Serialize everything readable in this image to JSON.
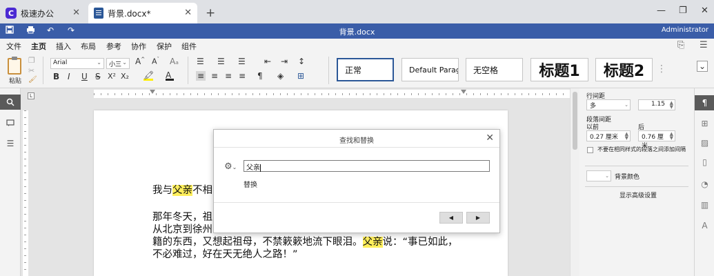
{
  "browser": {
    "tabs": [
      {
        "label": "极速办公",
        "active": false
      },
      {
        "label": "背景.docx*",
        "active": true
      }
    ],
    "new_tab": "+",
    "controls": {
      "minimize": "—",
      "restore": "❐",
      "close": "✕"
    }
  },
  "titlebar": {
    "doc_title": "背景.docx",
    "user": "Administrator",
    "quick_access": [
      "save-icon",
      "print-icon",
      "undo-icon",
      "redo-icon"
    ]
  },
  "menu": {
    "items": [
      "文件",
      "主页",
      "插入",
      "布局",
      "参考",
      "协作",
      "保护",
      "组件"
    ],
    "active": "主页"
  },
  "ribbon": {
    "paste_label": "粘贴",
    "font_name": "Arial",
    "font_size": "小三",
    "styles": [
      "正常",
      "Default Parag",
      "无空格",
      "标题1",
      "标题2"
    ],
    "format_buttons": [
      "B",
      "I",
      "U",
      "S",
      "X²",
      "X₂"
    ]
  },
  "document": {
    "lines": [
      {
        "pre": "我与",
        "hl": "父亲",
        "post": "不相"
      },
      {
        "pre": "那年冬天，祖",
        "hl": "",
        "post": ""
      },
      {
        "pre": "从北京到徐州",
        "hl": "",
        "post": ""
      },
      {
        "pre": "籍的东西，又想起祖母，不禁簌簌地流下眼泪。",
        "hl": "父亲",
        "post": "说：“事已如此，"
      },
      {
        "pre": "不必难过，好在天无绝人之路！”",
        "hl": "",
        "post": ""
      }
    ],
    "highlight_color": "#ffef5c"
  },
  "dialog": {
    "title": "查找和替换",
    "search_value": "父亲",
    "replace_label": "替换",
    "prev": "◀",
    "next": "▶"
  },
  "right_panel": {
    "line_spacing_label": "行间距",
    "line_spacing_mode": "多",
    "line_spacing_value": "1.15",
    "para_spacing_label": "段落间距",
    "before_label": "以前",
    "before_value": "0.27 厘米",
    "after_label": "后",
    "after_value": "0.76 厘米",
    "no_space_label": "不要在相同样式的段落之间添加间隔",
    "bg_color_label": "背景颜色",
    "advanced_link": "显示高级设置"
  },
  "colors": {
    "accent": "#3a5da8",
    "dark_strip": "#5a5a5a",
    "logo": "#4b2ad3"
  }
}
